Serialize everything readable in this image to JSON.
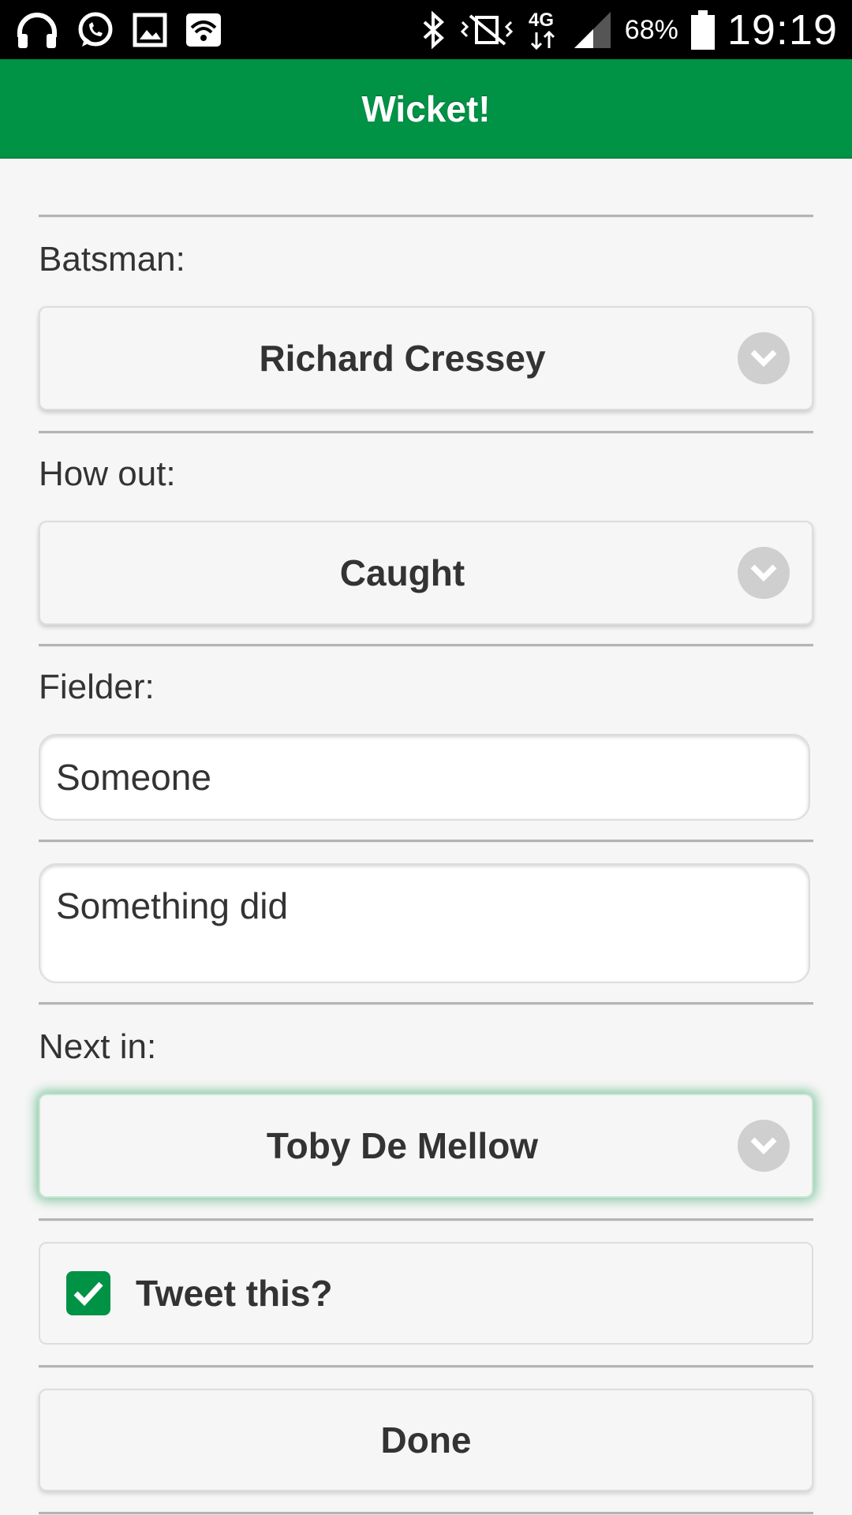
{
  "status_bar": {
    "battery_percent": "68%",
    "time": "19:19",
    "network_type": "4G",
    "icons_left": [
      "headphones-icon",
      "whatsapp-icon",
      "image-icon",
      "wifi-icon"
    ],
    "icons_right": [
      "bluetooth-icon",
      "vibrate-icon",
      "network-4g-icon",
      "signal-icon",
      "battery-icon"
    ]
  },
  "header": {
    "title": "Wicket!"
  },
  "form": {
    "batsman": {
      "label": "Batsman:",
      "value": "Richard Cressey"
    },
    "how_out": {
      "label": "How out:",
      "value": "Caught"
    },
    "fielder": {
      "label": "Fielder:",
      "value": "Someone"
    },
    "description": {
      "value": "Something did"
    },
    "next_in": {
      "label": "Next in:",
      "value": "Toby De Mellow"
    },
    "tweet": {
      "label": "Tweet this?",
      "checked": true
    },
    "done_label": "Done"
  },
  "colors": {
    "accent": "#009245",
    "background": "#f6f6f6"
  }
}
